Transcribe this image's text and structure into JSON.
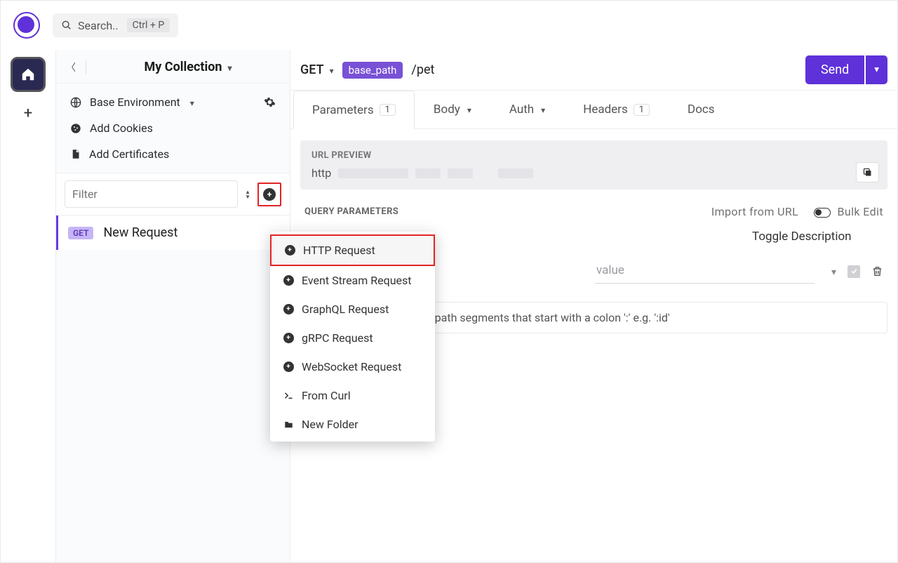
{
  "topbar": {
    "search_placeholder": "Search..",
    "kbd": "Ctrl + P"
  },
  "sidebar": {
    "title": "My Collection",
    "env_label": "Base Environment",
    "cookies_label": "Add Cookies",
    "certs_label": "Add Certificates",
    "filter_placeholder": "Filter",
    "request": {
      "method": "GET",
      "name": "New Request"
    }
  },
  "dropdown": {
    "items": [
      {
        "label": "HTTP Request",
        "icon": "plus"
      },
      {
        "label": "Event Stream Request",
        "icon": "plus"
      },
      {
        "label": "GraphQL Request",
        "icon": "plus"
      },
      {
        "label": "gRPC Request",
        "icon": "plus"
      },
      {
        "label": "WebSocket Request",
        "icon": "plus"
      },
      {
        "label": "From Curl",
        "icon": "terminal"
      },
      {
        "label": "New Folder",
        "icon": "folder"
      }
    ]
  },
  "main": {
    "method": "GET",
    "base_chip": "base_path",
    "url_path": "/pet",
    "send_label": "Send",
    "tabs": {
      "parameters": "Parameters",
      "parameters_count": "1",
      "body": "Body",
      "auth": "Auth",
      "headers": "Headers",
      "headers_count": "1",
      "docs": "Docs"
    },
    "url_preview_label": "URL PREVIEW",
    "url_preview_prefix": "http",
    "qp_label": "QUERY PARAMETERS",
    "import_url": "Import from URL",
    "bulk_edit": "Bulk Edit",
    "toggle_description": "Toggle Description",
    "value_placeholder": "value",
    "path_hint_prefix": "are url path segments that start with a colon ':' e.g. ':id'"
  }
}
